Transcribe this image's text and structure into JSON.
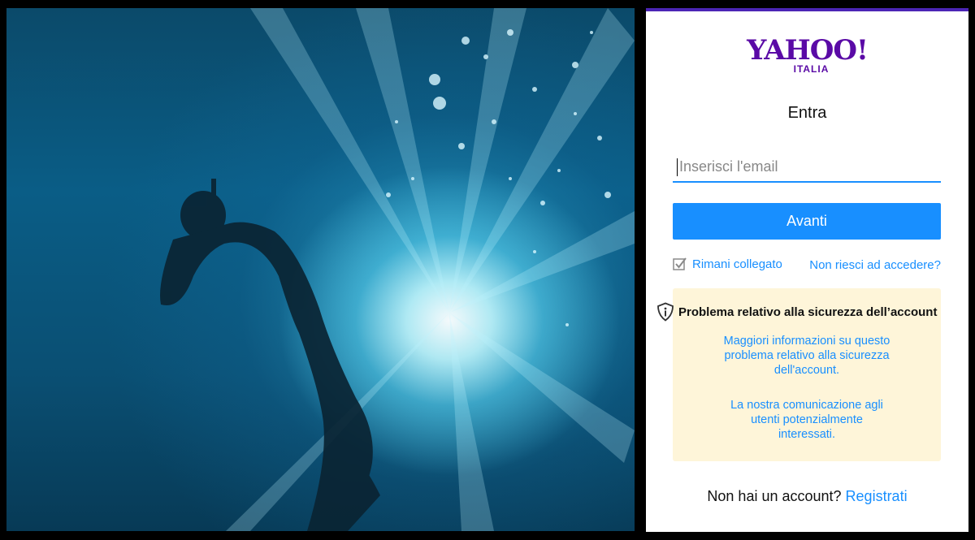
{
  "brand": {
    "logo": "YAHOO!",
    "region": "ITALIA",
    "accent_color": "#5a0aa6",
    "link_color": "#188fff"
  },
  "signin": {
    "title": "Entra",
    "email_placeholder": "Inserisci l'email",
    "email_value": "",
    "next_label": "Avanti",
    "remember_label": "Rimani collegato",
    "remember_checked": true,
    "forgot_label": "Non riesci ad accedere?"
  },
  "security_alert": {
    "icon": "shield-info-icon",
    "title": "Problema relativo alla sicurezza dell’account",
    "link_more_info": "Maggiori informazioni su questo problema relativo alla sicurezza dell'account.",
    "link_communication": "La nostra comunicazione agli utenti potenzialmente interessati."
  },
  "signup": {
    "prompt": "Non hai un account?",
    "link": "Registrati"
  }
}
